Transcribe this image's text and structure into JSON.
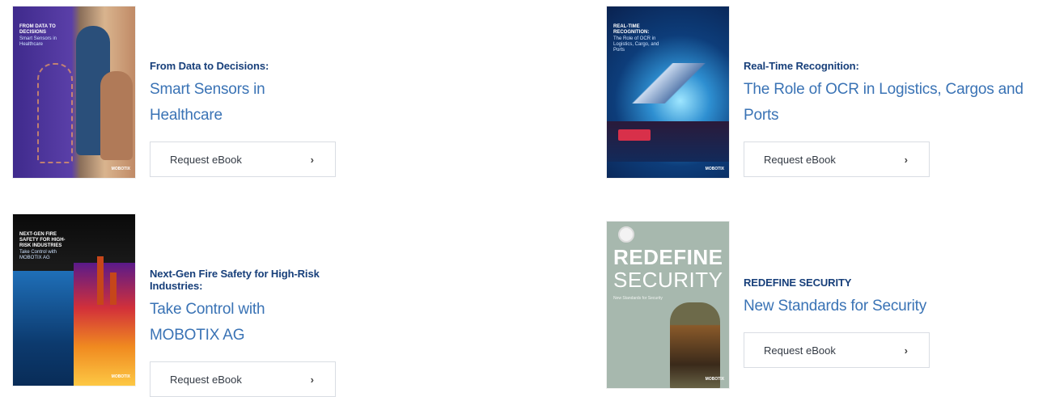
{
  "cards": [
    {
      "heading": "From Data to Decisions:",
      "subtitle": "Smart Sensors in Healthcare",
      "button_label": "Request eBook",
      "cover_title": "From Data to Decisions",
      "cover_subtitle": "Smart Sensors in Healthcare",
      "cover_brand": "MOBOTIX"
    },
    {
      "heading": "Real-Time Recognition:",
      "subtitle": "The Role of OCR in Logistics, Cargos and Ports",
      "button_label": "Request eBook",
      "cover_title": "Real-Time Recognition:",
      "cover_subtitle": "The Role of OCR in Logistics, Cargo, and Ports",
      "cover_brand": "MOBOTIX"
    },
    {
      "heading": "Next-Gen Fire Safety for High-Risk Industries:",
      "subtitle": "Take Control with MOBOTIX AG",
      "button_label": "Request eBook",
      "cover_title": "Next-Gen Fire Safety for High-Risk Industries",
      "cover_subtitle": "Take Control with MOBOTIX AG",
      "cover_brand": "MOBOTIX"
    },
    {
      "heading": "REDEFINE SECURITY",
      "subtitle": "New Standards for Security",
      "button_label": "Request eBook",
      "cover_title_line1": "REDEFINE",
      "cover_title_line2": "SECURITY",
      "cover_subtitle": "New Standards for Security",
      "cover_brand": "MOBOTIX"
    }
  ],
  "icons": {
    "chevron": "›"
  },
  "colors": {
    "heading": "#173f7a",
    "subtitle": "#3a73b5",
    "button_border": "#d9dde3"
  }
}
